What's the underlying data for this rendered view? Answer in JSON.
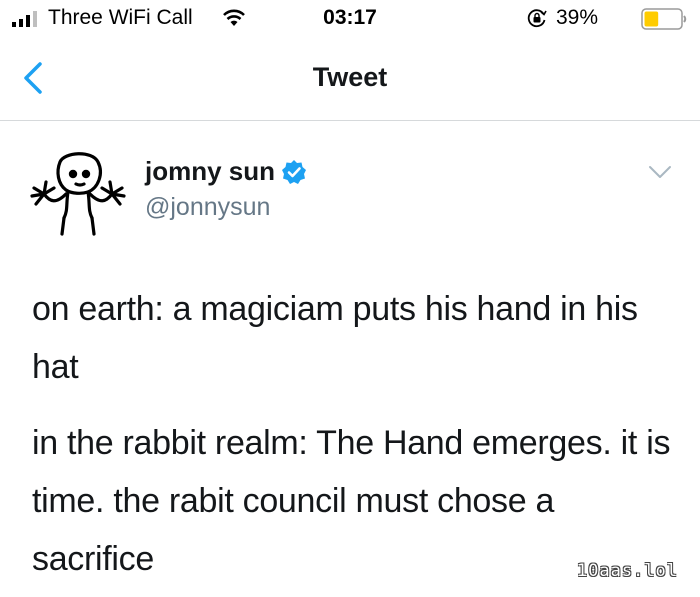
{
  "status_bar": {
    "carrier": "Three WiFi Call",
    "time": "03:17",
    "battery_percent": "39%",
    "battery_level": 0.39,
    "battery_color": "#ffcc00"
  },
  "nav": {
    "title": "Tweet",
    "back_icon": "chevron-left-icon",
    "accent_color": "#1da1f2"
  },
  "tweet": {
    "display_name": "jomny sun",
    "handle": "@jonnysun",
    "verified": true,
    "paragraphs": [
      "on earth: a magiciam puts his hand in his hat",
      "in the rabbit realm: The Hand emerges. it is time. the rabit council must chose a sacrifice"
    ]
  },
  "watermark": "10aas.lol"
}
